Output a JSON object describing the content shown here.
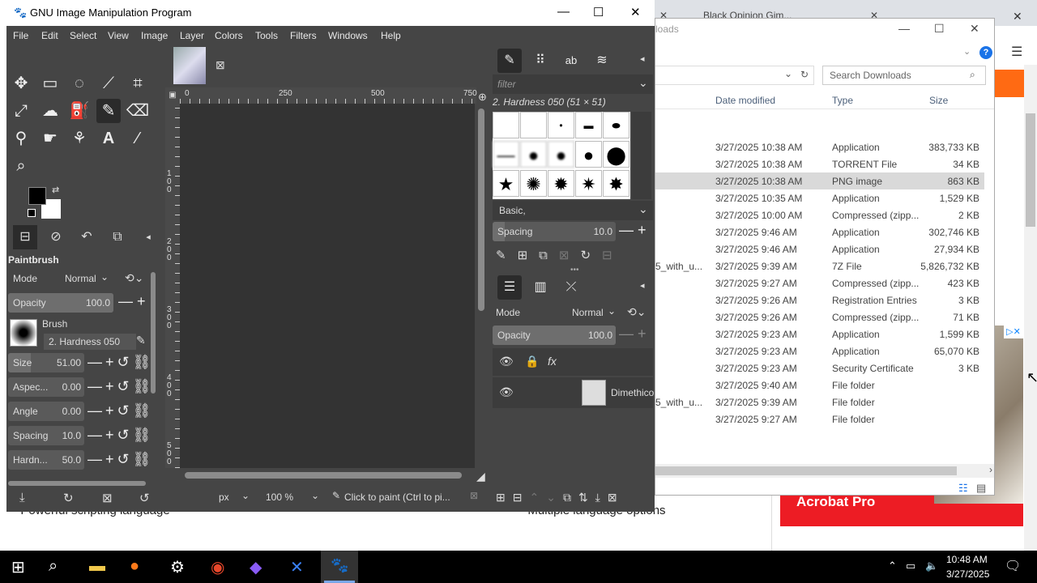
{
  "gimp": {
    "title": "GNU Image Manipulation Program",
    "menu": [
      "File",
      "Edit",
      "Select",
      "View",
      "Image",
      "Layer",
      "Colors",
      "Tools",
      "Filters",
      "Windows",
      "Help"
    ],
    "tool_options": {
      "title": "Paintbrush",
      "mode_label": "Mode",
      "mode_value": "Normal",
      "opacity_label": "Opacity",
      "opacity_value": "100.0",
      "brush_label": "Brush",
      "brush_value": "2. Hardness 050",
      "sliders": [
        {
          "label": "Size",
          "value": "51.00"
        },
        {
          "label": "Aspec...",
          "value": "0.00"
        },
        {
          "label": "Angle",
          "value": "0.00"
        },
        {
          "label": "Spacing",
          "value": "10.0"
        },
        {
          "label": "Hardn...",
          "value": "50.0"
        }
      ]
    },
    "rulers": {
      "top": [
        "0",
        "250",
        "500",
        "750"
      ],
      "left": [
        "1 0 0",
        "2 0 0",
        "3 0 0",
        "4 0 0",
        "5 0 0"
      ]
    },
    "status": {
      "unit": "px",
      "zoom": "100 %",
      "message": "Click to paint (Ctrl to pi..."
    },
    "brushes": {
      "filter_placeholder": "filter",
      "selected": "2. Hardness 050 (51 × 51)",
      "tag": "Basic,",
      "spacing_label": "Spacing",
      "spacing_value": "10.0"
    },
    "layers": {
      "mode_label": "Mode",
      "mode_value": "Normal",
      "opacity_label": "Opacity",
      "opacity_value": "100.0",
      "layer_name": "Dimethico"
    }
  },
  "explorer": {
    "title": "loads",
    "search_placeholder": "Search Downloads",
    "columns": [
      "Date modified",
      "Type",
      "Size"
    ],
    "rows": [
      {
        "name": "",
        "date": "3/27/2025 10:38 AM",
        "type": "Application",
        "size": "383,733 KB",
        "selected": false
      },
      {
        "name": "",
        "date": "3/27/2025 10:38 AM",
        "type": "TORRENT File",
        "size": "34 KB",
        "selected": false
      },
      {
        "name": "",
        "date": "3/27/2025 10:38 AM",
        "type": "PNG image",
        "size": "863 KB",
        "selected": true
      },
      {
        "name": "",
        "date": "3/27/2025 10:35 AM",
        "type": "Application",
        "size": "1,529 KB",
        "selected": false
      },
      {
        "name": "",
        "date": "3/27/2025 10:00 AM",
        "type": "Compressed (zipp...",
        "size": "2 KB",
        "selected": false
      },
      {
        "name": "",
        "date": "3/27/2025 9:46 AM",
        "type": "Application",
        "size": "302,746 KB",
        "selected": false
      },
      {
        "name": "",
        "date": "3/27/2025 9:46 AM",
        "type": "Application",
        "size": "27,934 KB",
        "selected": false
      },
      {
        "name": "5_with_u...",
        "date": "3/27/2025 9:39 AM",
        "type": "7Z File",
        "size": "5,826,732 KB",
        "selected": false
      },
      {
        "name": "",
        "date": "3/27/2025 9:27 AM",
        "type": "Compressed (zipp...",
        "size": "423 KB",
        "selected": false
      },
      {
        "name": "",
        "date": "3/27/2025 9:26 AM",
        "type": "Registration Entries",
        "size": "3 KB",
        "selected": false
      },
      {
        "name": "",
        "date": "3/27/2025 9:26 AM",
        "type": "Compressed (zipp...",
        "size": "71 KB",
        "selected": false
      },
      {
        "name": "",
        "date": "3/27/2025 9:23 AM",
        "type": "Application",
        "size": "1,599 KB",
        "selected": false
      },
      {
        "name": "",
        "date": "3/27/2025 9:23 AM",
        "type": "Application",
        "size": "65,070 KB",
        "selected": false
      },
      {
        "name": "",
        "date": "3/27/2025 9:23 AM",
        "type": "Security Certificate",
        "size": "3 KB",
        "selected": false
      },
      {
        "name": "",
        "date": "3/27/2025 9:40 AM",
        "type": "File folder",
        "size": "",
        "selected": false
      },
      {
        "name": "5_with_u...",
        "date": "3/27/2025 9:39 AM",
        "type": "File folder",
        "size": "",
        "selected": false
      },
      {
        "name": "",
        "date": "3/27/2025 9:27 AM",
        "type": "File folder",
        "size": "",
        "selected": false
      }
    ]
  },
  "web": {
    "tab_text": "Black Opinion Gim...",
    "text_left": "• Powerful scripting language",
    "text_right": "• Multiple language options",
    "ad_text": "Acrobat Pro"
  },
  "taskbar": {
    "time": "10:48 AM",
    "date": "3/27/2025"
  }
}
